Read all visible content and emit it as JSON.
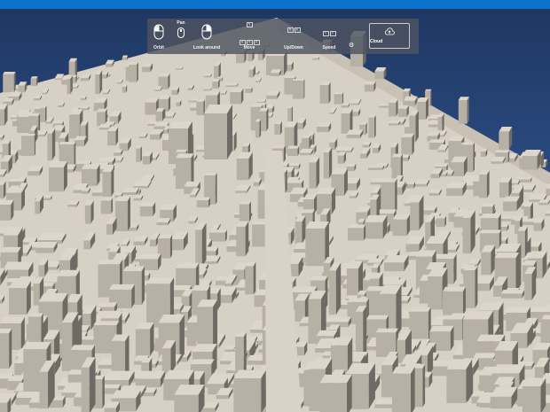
{
  "toolbar": {
    "orbit_label": "Orbit",
    "pan_label": "Pan",
    "look_label": "Look around",
    "move_label": "Move",
    "updown_label": "Up/Down",
    "speed_label": "Speed",
    "cloud_label": "Cloud",
    "move_keys_top": [
      "W"
    ],
    "move_keys_bottom": [
      "A",
      "S",
      "D"
    ],
    "updown_keys": [
      "Q",
      "E"
    ],
    "speed_keys": [
      "1",
      "2"
    ]
  },
  "icons": {
    "orbit": "orbit-mouse-icon",
    "pan": "pan-mouse-icon",
    "look": "look-mouse-icon",
    "move": "wasd-keys-icon",
    "updown": "qe-keys-icon",
    "speed": "speed-keys-icon",
    "settings": "gear-icon",
    "cloud": "cloud-upload-icon"
  },
  "colors": {
    "top_bar": "#0d72cf",
    "sky": "#2a4a80",
    "ground": "#d7d0c4",
    "buildings": "#cac3b7",
    "panel": "#4e5460"
  }
}
